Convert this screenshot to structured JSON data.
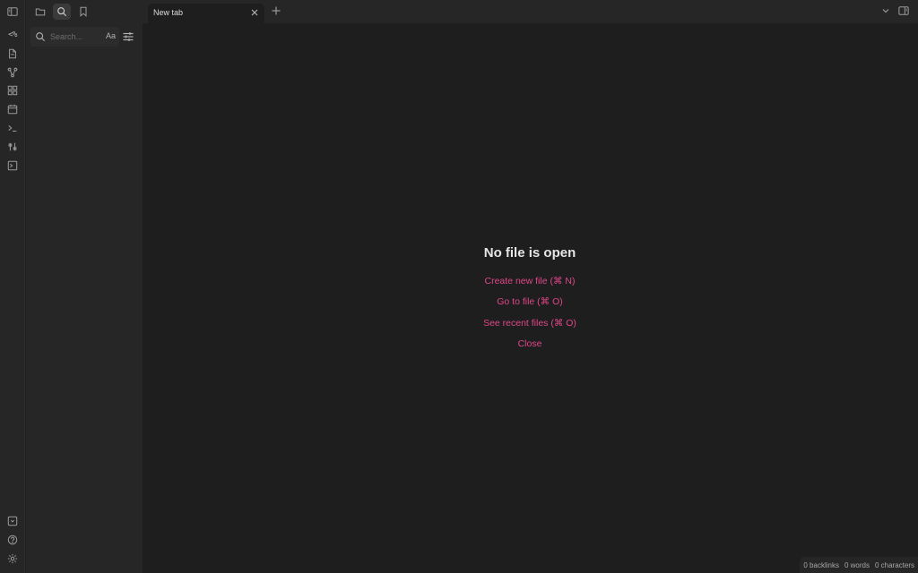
{
  "ribbon": {
    "templater_label": "<%",
    "icons": [
      "sidebar-toggle-icon",
      "templater-icon",
      "new-file-icon",
      "graph-icon",
      "canvas-icon",
      "calendar-icon",
      "command-palette-icon",
      "slides-icon",
      "terminal-icon",
      "vault-switcher-icon",
      "help-icon",
      "settings-icon"
    ]
  },
  "left_panel": {
    "tabs": [
      "files-icon",
      "search-icon",
      "bookmark-icon"
    ],
    "active_tab": "search",
    "search": {
      "placeholder": "Search...",
      "value": "",
      "match_case_label": "Aa"
    }
  },
  "tabs": [
    {
      "title": "New tab",
      "active": true
    }
  ],
  "main": {
    "empty_title": "No file is open",
    "actions": [
      {
        "label": "Create new file (⌘ N)"
      },
      {
        "label": "Go to file (⌘ O)"
      },
      {
        "label": "See recent files (⌘ O)"
      },
      {
        "label": "Close"
      }
    ]
  },
  "status_bar": {
    "backlinks": "0 backlinks",
    "words": "0 words",
    "characters": "0 characters"
  },
  "colors": {
    "accent": "#e0478a",
    "background": "#1e1e1e",
    "sidebar": "#262626"
  }
}
